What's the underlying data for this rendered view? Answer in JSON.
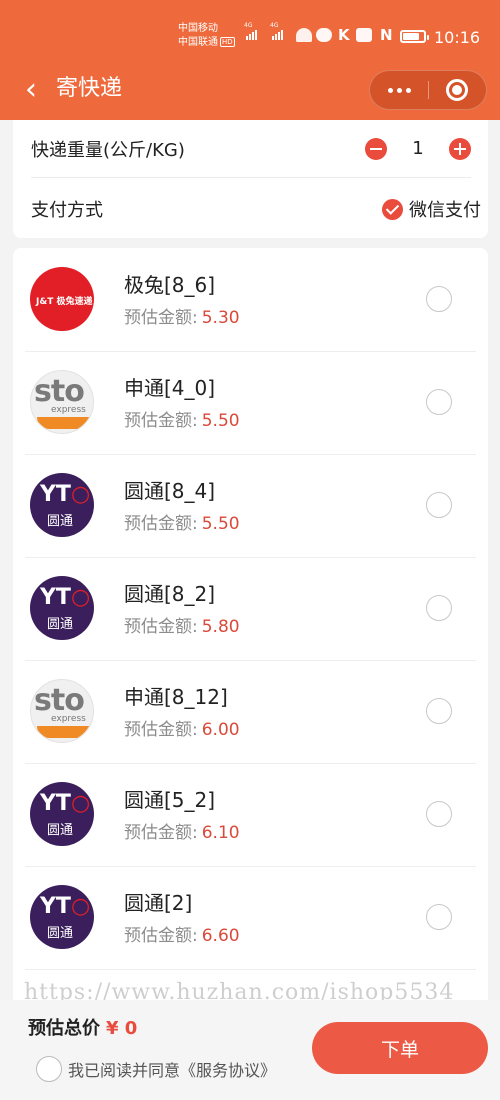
{
  "status_bar": {
    "carrier1": "中国移动",
    "carrier2": "中国联通",
    "hd_tag": "HD",
    "net_tag1": "4G",
    "net_tag2": "4G",
    "time": "10:16"
  },
  "header": {
    "back_icon": "chevron-left-icon",
    "title": "寄快递",
    "accent_color": "#ee6a3c"
  },
  "settings": {
    "weight_label": "快递重量(公斤/KG)",
    "weight_value": "1",
    "payment_label": "支付方式",
    "payment_option": "微信支付"
  },
  "couriers": [
    {
      "name": "极兔[8_6]",
      "fee_label": "预估金额:",
      "fee": "5.30",
      "logo_text": "J&T 极兔速递"
    },
    {
      "name": "申通[4_0]",
      "fee_label": "预估金额:",
      "fee": "5.50",
      "logo_text": "sto"
    },
    {
      "name": "圆通[8_4]",
      "fee_label": "预估金额:",
      "fee": "5.50",
      "logo_text": "圆通"
    },
    {
      "name": "圆通[8_2]",
      "fee_label": "预估金额:",
      "fee": "5.80",
      "logo_text": "圆通"
    },
    {
      "name": "申通[8_12]",
      "fee_label": "预估金额:",
      "fee": "6.00",
      "logo_text": "sto"
    },
    {
      "name": "圆通[5_2]",
      "fee_label": "预估金额:",
      "fee": "6.10",
      "logo_text": "圆通"
    },
    {
      "name": "圆通[2]",
      "fee_label": "预估金额:",
      "fee": "6.60",
      "logo_text": "圆通"
    }
  ],
  "logos": {
    "sto_sub": "express",
    "yt_mark": "YT"
  },
  "watermark": "https://www.huzhan.com/ishop5534",
  "footer": {
    "total_label": "预估总价",
    "total_value": "¥ 0",
    "agreement": "我已阅读并同意《服务协议》",
    "order_button": "下单",
    "button_color": "#ec5a45"
  }
}
